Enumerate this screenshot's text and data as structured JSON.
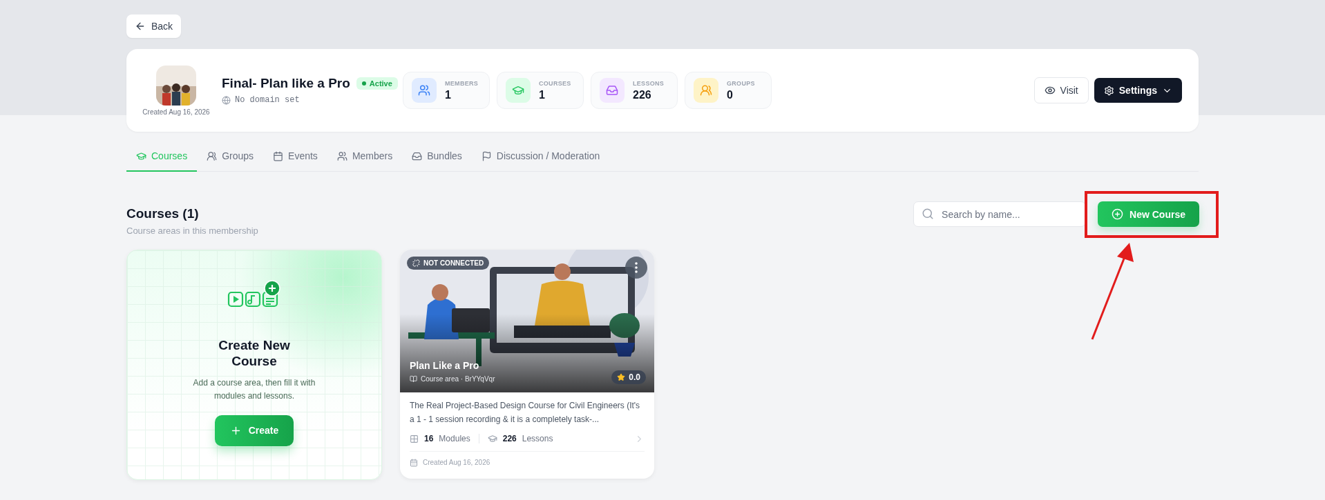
{
  "back_button": {
    "label": "Back"
  },
  "membership": {
    "created": "Created Aug 16, 2026",
    "title": "Final- Plan like a Pro",
    "status": {
      "label": "Active",
      "active": true
    },
    "domain": "No domain set"
  },
  "stats": [
    {
      "kind": "members",
      "label": "MEMBERS",
      "value": "1"
    },
    {
      "kind": "courses",
      "label": "COURSES",
      "value": "1"
    },
    {
      "kind": "lessons",
      "label": "LESSONS",
      "value": "226"
    },
    {
      "kind": "groups",
      "label": "GROUPS",
      "value": "0"
    }
  ],
  "actions": {
    "visit": "Visit",
    "settings": "Settings"
  },
  "tabs": [
    {
      "kind": "courses",
      "label": "Courses",
      "selected": true
    },
    {
      "kind": "groups",
      "label": "Groups",
      "selected": false
    },
    {
      "kind": "events",
      "label": "Events",
      "selected": false
    },
    {
      "kind": "members",
      "label": "Members",
      "selected": false
    },
    {
      "kind": "bundles",
      "label": "Bundles",
      "selected": false
    },
    {
      "kind": "discussion",
      "label": "Discussion / Moderation",
      "selected": false
    }
  ],
  "section": {
    "title": "Courses (1)",
    "subtitle": "Course areas in this membership"
  },
  "search": {
    "placeholder": "Search by name..."
  },
  "new_course_button": {
    "label": "New Course",
    "highlighted": true
  },
  "create_card": {
    "title": "Create New Course",
    "description": "Add a course area, then fill it with modules and lessons.",
    "button": "Create"
  },
  "courses": [
    {
      "badge": "NOT CONNECTED",
      "title": "Plan Like a Pro",
      "area": "Course area · BrYYqVqr",
      "rating": "0.0",
      "description": "The Real Project-Based Design Course for Civil Engineers (It's a 1 - 1 session recording & it is a completely task-...",
      "modules_count": "16",
      "modules_label": "Modules",
      "lessons_count": "226",
      "lessons_label": "Lessons",
      "created": "Created Aug 16, 2026"
    }
  ]
}
